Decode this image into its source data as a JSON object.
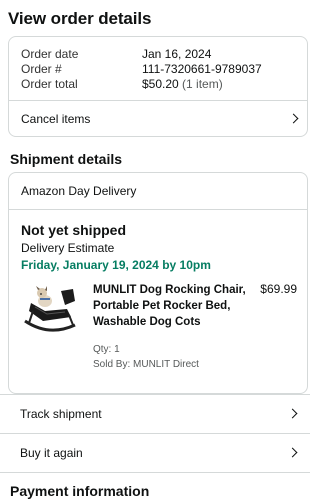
{
  "page": {
    "title": "View order details"
  },
  "summary": {
    "order_date_label": "Order date",
    "order_date": "Jan 16, 2024",
    "order_number_label": "Order #",
    "order_number": "111-7320661-9789037",
    "order_total_label": "Order total",
    "order_total": "$50.20",
    "item_count": "(1 item)",
    "cancel_label": "Cancel items"
  },
  "shipment": {
    "section_title": "Shipment details",
    "delivery_type": "Amazon Day Delivery",
    "status": "Not yet shipped",
    "estimate_label": "Delivery Estimate",
    "estimate_date": "Friday, January 19, 2024 by 10pm",
    "product": {
      "title": "MUNLIT Dog Rocking Chair, Portable Pet Rocker Bed, Washable Dog Cots",
      "price": "$69.99",
      "qty": "Qty: 1",
      "sold_by": "Sold By: MUNLIT Direct",
      "image_icon": "product-image-rocking-chair"
    }
  },
  "actions": {
    "track_label": "Track shipment",
    "buy_again_label": "Buy it again"
  },
  "payment": {
    "section_title": "Payment information"
  },
  "colors": {
    "accent_green": "#067d62",
    "border": "#d5d9d9",
    "text": "#0f1111"
  }
}
